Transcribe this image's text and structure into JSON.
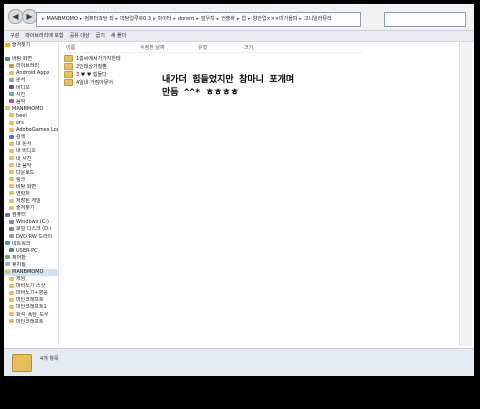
{
  "address": {
    "crumbs": [
      "MANBMOMO",
      "컴퓨터과당 최",
      "마탕업루르0.3",
      "마이터",
      "dorent",
      "발우치",
      "언출하",
      "업",
      "양안업×××미가을파",
      "고니일러뮤리"
    ]
  },
  "toolbar": {
    "items": [
      "구성",
      "라이브러리에 포함",
      "공유 대상",
      "굽기",
      "새 폴더"
    ]
  },
  "sidebar": {
    "items": [
      {
        "label": "즐겨찾기",
        "icon": "star-icon",
        "selected": false
      },
      {
        "label": "",
        "icon": "",
        "selected": false
      },
      {
        "label": "바탕 화면",
        "icon": "desktop-icon",
        "selected": false
      },
      {
        "label": "라이브러리",
        "icon": "library-icon",
        "selected": false
      },
      {
        "label": "Android Apps",
        "icon": "folder-icon",
        "selected": false
      },
      {
        "label": "문서",
        "icon": "document-icon",
        "selected": false
      },
      {
        "label": "비디오",
        "icon": "video-icon",
        "selected": false
      },
      {
        "label": "사진",
        "icon": "picture-icon",
        "selected": false
      },
      {
        "label": "음악",
        "icon": "music-icon",
        "selected": false
      },
      {
        "label": "MANBMOMO",
        "icon": "user-icon",
        "selected": false
      },
      {
        "label": "heel",
        "icon": "folder-icon",
        "selected": false
      },
      {
        "label": "ors",
        "icon": "folder-icon",
        "selected": false
      },
      {
        "label": "AdobeGames Log",
        "icon": "folder-icon",
        "selected": false
      },
      {
        "label": "검색",
        "icon": "search-icon",
        "selected": false
      },
      {
        "label": "내 문서",
        "icon": "folder-icon",
        "selected": false
      },
      {
        "label": "내 비디오",
        "icon": "folder-icon",
        "selected": false
      },
      {
        "label": "내 사진",
        "icon": "folder-icon",
        "selected": false
      },
      {
        "label": "내 음악",
        "icon": "folder-icon",
        "selected": false
      },
      {
        "label": "다운로드",
        "icon": "folder-icon",
        "selected": false
      },
      {
        "label": "링크",
        "icon": "folder-icon",
        "selected": false
      },
      {
        "label": "바탕 화면",
        "icon": "folder-icon",
        "selected": false
      },
      {
        "label": "연락처",
        "icon": "folder-icon",
        "selected": false
      },
      {
        "label": "저장된 게임",
        "icon": "folder-icon",
        "selected": false
      },
      {
        "label": "즐겨찾기",
        "icon": "folder-icon",
        "selected": false
      },
      {
        "label": "컴퓨터",
        "icon": "computer-icon",
        "selected": false
      },
      {
        "label": "Windows (C:)",
        "icon": "drive-icon",
        "selected": false
      },
      {
        "label": "로컬 디스크 (D:)",
        "icon": "drive-icon",
        "selected": false
      },
      {
        "label": "DVD RW 드라이",
        "icon": "dvd-icon",
        "selected": false
      },
      {
        "label": "네트워크",
        "icon": "network-icon",
        "selected": false
      },
      {
        "label": "USER-PC",
        "icon": "computer-icon",
        "selected": false
      },
      {
        "label": "제어판",
        "icon": "control-panel-icon",
        "selected": false
      },
      {
        "label": "휴지통",
        "icon": "trash-icon",
        "selected": false
      },
      {
        "label": "MANBMOMO",
        "icon": "folder-icon",
        "selected": true
      },
      {
        "label": "게임",
        "icon": "folder-icon",
        "selected": false
      },
      {
        "label": "마비노기 스샷",
        "icon": "folder-icon",
        "selected": false
      },
      {
        "label": "마비노기+영웅",
        "icon": "folder-icon",
        "selected": false
      },
      {
        "label": "마인크래프트",
        "icon": "folder-icon",
        "selected": false
      },
      {
        "label": "마인크래프트1",
        "icon": "folder-icon",
        "selected": false
      },
      {
        "label": "화석_폭탄_도우",
        "icon": "folder-icon",
        "selected": false
      },
      {
        "label": "마인크래프트",
        "icon": "folder-icon",
        "selected": false
      }
    ]
  },
  "columns": [
    "이름",
    "",
    "수정한 날짜",
    "유형",
    "크기"
  ],
  "files": [
    {
      "name": "1층씨에서가가지한테"
    },
    {
      "name": "2인데상가질뿐"
    },
    {
      "name": "3 ♥ ♥ 힘들다"
    },
    {
      "name": "4일내 가점아뮤어"
    }
  ],
  "annotation": {
    "line1": "내가더  힘들었지만  참마니  포개며",
    "line2": "만듬 ^^*  ㅎㅎㅎㅎ"
  },
  "status": {
    "count": "4개 항목"
  },
  "colors": {
    "folder": "#e6bf5a",
    "selection": "#cde4f7",
    "toolbar": "#e9edf2"
  }
}
